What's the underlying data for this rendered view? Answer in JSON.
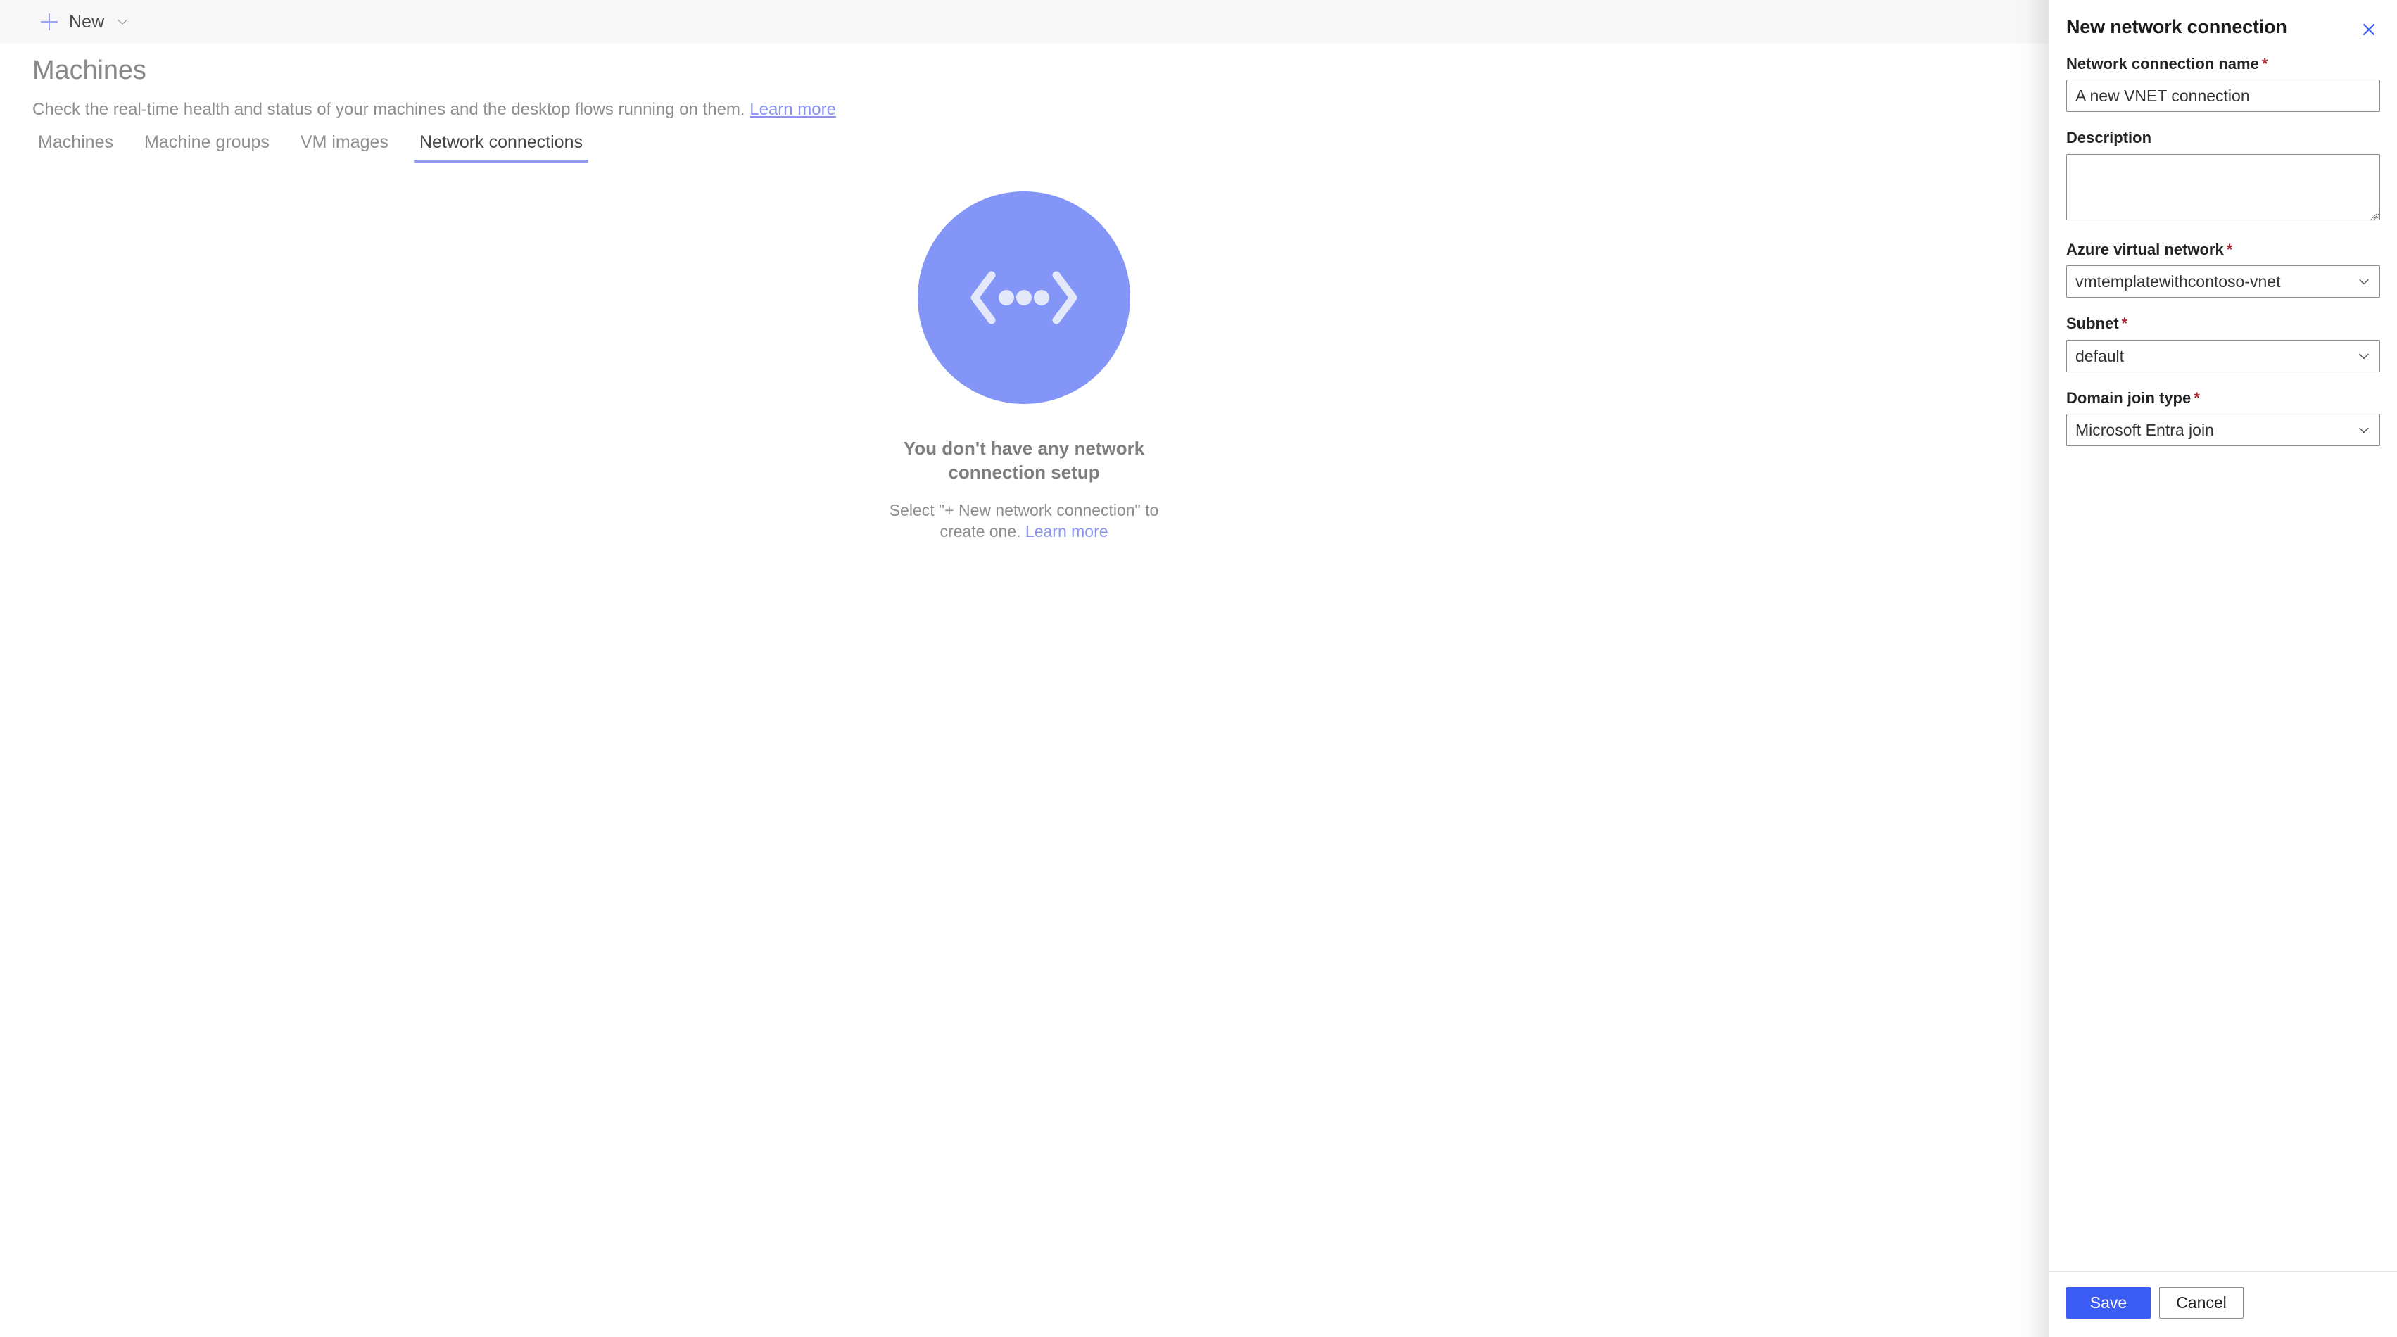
{
  "toolbar": {
    "new_label": "New",
    "plus_icon": "plus-icon",
    "chevron_icon": "chevron-down-icon"
  },
  "page": {
    "title": "Machines",
    "subtitle": "Check the real-time health and status of your machines and the desktop flows running on them.",
    "subtitle_link": "Learn more"
  },
  "tabs": [
    {
      "label": "Machines",
      "active": false
    },
    {
      "label": "Machine groups",
      "active": false
    },
    {
      "label": "VM images",
      "active": false
    },
    {
      "label": "Network connections",
      "active": true
    }
  ],
  "empty_state": {
    "illustration": "network-connection-illustration",
    "illustration_color": "#8395f7",
    "title": "You don't have any network connection setup",
    "description": "Select \"+ New network connection\" to create one. ",
    "description_link": "Learn more"
  },
  "panel": {
    "title": "New network connection",
    "close_icon": "close-icon",
    "close_icon_color": "#3b5bf5",
    "fields": {
      "name": {
        "label": "Network connection name",
        "required": true,
        "value": "A new VNET connection",
        "placeholder": ""
      },
      "description": {
        "label": "Description",
        "required": false,
        "value": "",
        "placeholder": ""
      },
      "vnet": {
        "label": "Azure virtual network",
        "required": true,
        "value": "vmtemplatewithcontoso-vnet",
        "chevron_icon": "chevron-down-icon"
      },
      "subnet": {
        "label": "Subnet",
        "required": true,
        "value": "default",
        "chevron_icon": "chevron-down-icon"
      },
      "domain_join": {
        "label": "Domain join type",
        "required": true,
        "value": "Microsoft Entra join",
        "chevron_icon": "chevron-down-icon"
      }
    },
    "footer": {
      "save_label": "Save",
      "cancel_label": "Cancel",
      "save_color": "#3b5bf5"
    }
  },
  "required_marker": "*"
}
